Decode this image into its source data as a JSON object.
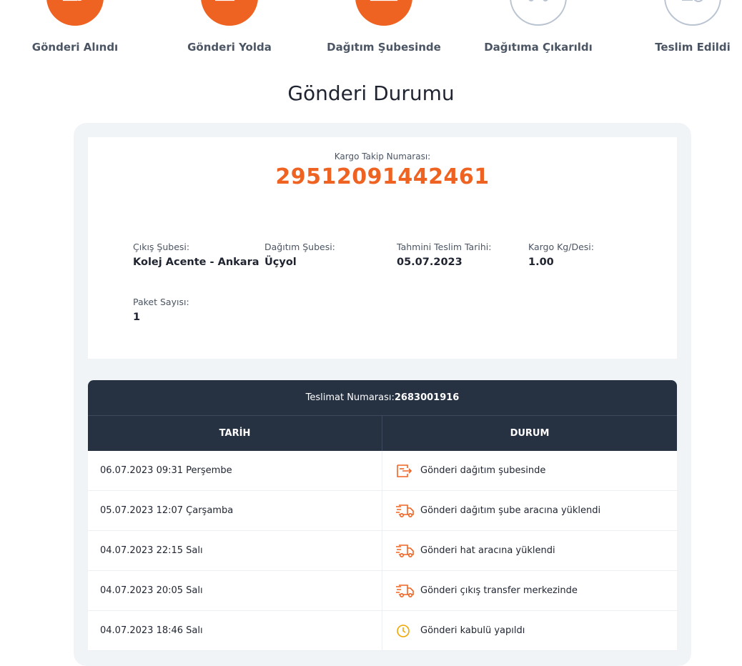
{
  "steps": [
    {
      "label": "Gönderi Alındı",
      "state": "done",
      "icon": "receipt-clock-icon"
    },
    {
      "label": "Gönderi Yolda",
      "state": "done",
      "icon": "transfer-arrow-icon"
    },
    {
      "label": "Dağıtım Şubesinde",
      "state": "done",
      "icon": "warehouse-icon"
    },
    {
      "label": "Dağıtıma Çıkarıldı",
      "state": "pending",
      "icon": "delivery-truck-icon"
    },
    {
      "label": "Teslim Edildi",
      "state": "pending",
      "icon": "delivered-check-icon"
    }
  ],
  "title": "Gönderi Durumu",
  "tracking": {
    "label": "Kargo Takip Numarası:",
    "number": "29512091442461"
  },
  "details": {
    "exit_branch": {
      "label": "Çıkış Şubesi:",
      "value": "Kolej Acente - Ankara"
    },
    "delivery_branch": {
      "label": "Dağıtım Şubesi:",
      "value": "Üçyol"
    },
    "estimated_date": {
      "label": "Tahmini Teslim Tarihi:",
      "value": "05.07.2023"
    },
    "weight": {
      "label": "Kargo Kg/Desi:",
      "value": "1.00"
    },
    "package_count": {
      "label": "Paket Sayısı:",
      "value": "1"
    }
  },
  "history": {
    "delivery_label": "Teslimat Numarası:",
    "delivery_number": "2683001916",
    "col_date": "TARİH",
    "col_status": "DURUM",
    "rows": [
      {
        "date": "06.07.2023 09:31 Perşembe",
        "status": "Gönderi dağıtım şubesinde",
        "icon": "branch-box-icon"
      },
      {
        "date": "05.07.2023 12:07 Çarşamba",
        "status": "Gönderi dağıtım şube aracına yüklendi",
        "icon": "truck-icon"
      },
      {
        "date": "04.07.2023 22:15 Salı",
        "status": "Gönderi hat aracına yüklendi",
        "icon": "truck-icon"
      },
      {
        "date": "04.07.2023 20:05 Salı",
        "status": "Gönderi çıkış transfer merkezinde",
        "icon": "truck-icon"
      },
      {
        "date": "04.07.2023 18:46 Salı",
        "status": "Gönderi kabulü yapıldı",
        "icon": "clock-icon"
      }
    ]
  },
  "colors": {
    "accent": "#ef6322",
    "header_bg": "#263142",
    "panel_bg": "#f1f4f7",
    "pending": "#b9c3d1",
    "clock": "#f0a500"
  }
}
